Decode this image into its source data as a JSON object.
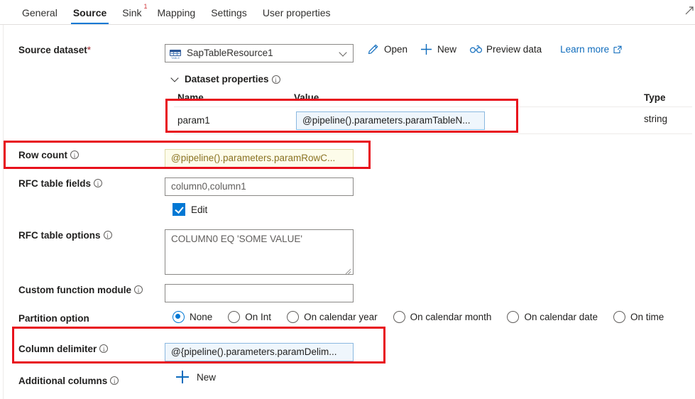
{
  "tabs": [
    {
      "label": "General",
      "active": false,
      "badge": null
    },
    {
      "label": "Source",
      "active": true,
      "badge": null
    },
    {
      "label": "Sink",
      "active": false,
      "badge": "1"
    },
    {
      "label": "Mapping",
      "active": false,
      "badge": null
    },
    {
      "label": "Settings",
      "active": false,
      "badge": null
    },
    {
      "label": "User properties",
      "active": false,
      "badge": null
    }
  ],
  "source_dataset": {
    "label": "Source dataset",
    "required_marker": "*",
    "value": "SapTableResource1",
    "icon": "sap-table-icon",
    "commands": [
      {
        "label": "Open",
        "icon": "pencil-icon"
      },
      {
        "label": "New",
        "icon": "plus-icon"
      },
      {
        "label": "Preview data",
        "icon": "glasses-icon"
      }
    ],
    "learn_more": "Learn more"
  },
  "dataset_properties": {
    "title": "Dataset properties",
    "columns": [
      "Name",
      "Value",
      "Type"
    ],
    "rows": [
      {
        "name": "param1",
        "value": "@pipeline().parameters.paramTableN...",
        "type": "string"
      }
    ]
  },
  "fields": {
    "row_count": {
      "label": "Row count",
      "value": "@pipeline().parameters.paramRowC..."
    },
    "rfc_table_fields": {
      "label": "RFC table fields",
      "value": "column0,column1"
    },
    "edit_checkbox": {
      "label": "Edit",
      "checked": true
    },
    "rfc_table_options": {
      "label": "RFC table options",
      "value": "COLUMN0 EQ 'SOME VALUE'"
    },
    "custom_function_module": {
      "label": "Custom function module",
      "value": ""
    },
    "partition_option": {
      "label": "Partition option",
      "options": [
        {
          "label": "None",
          "selected": true
        },
        {
          "label": "On Int",
          "selected": false
        },
        {
          "label": "On calendar year",
          "selected": false
        },
        {
          "label": "On calendar month",
          "selected": false
        },
        {
          "label": "On calendar date",
          "selected": false
        },
        {
          "label": "On time",
          "selected": false
        }
      ]
    },
    "column_delimiter": {
      "label": "Column delimiter",
      "value": "@{pipeline().parameters.paramDelim..."
    },
    "additional_columns": {
      "label": "Additional columns",
      "new_label": "New"
    }
  },
  "colors": {
    "accent": "#0078d4",
    "link": "#0f6cbd",
    "annotation": "#e8111c",
    "required": "#a4262c",
    "badge": "#d13438",
    "param_input_bg": "#eff6fc",
    "row_count_bg": "#fdfcea"
  }
}
